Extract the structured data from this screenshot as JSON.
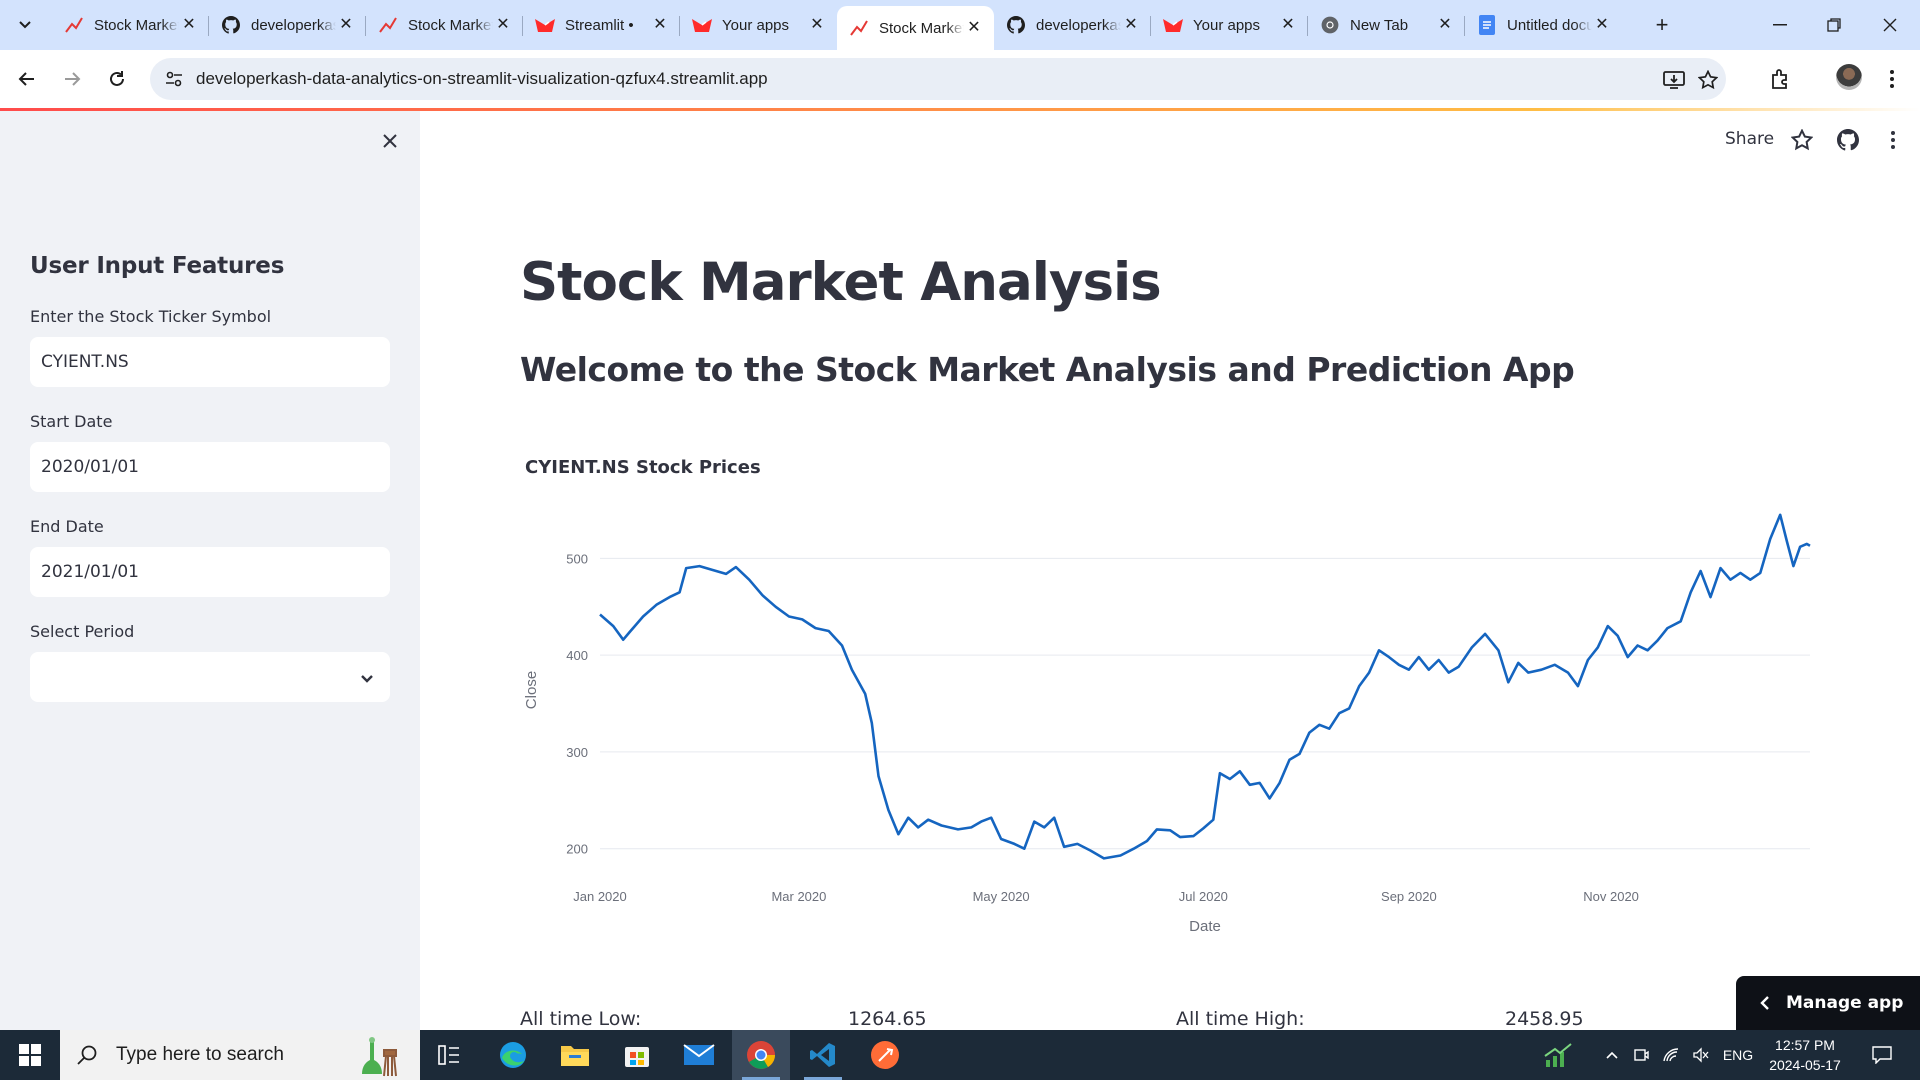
{
  "browser": {
    "tabs": [
      {
        "title": "Stock Market Analysis",
        "icon": "trend-icon",
        "active": false
      },
      {
        "title": "developerkash",
        "icon": "github-icon",
        "active": false
      },
      {
        "title": "Stock Market Analysis",
        "icon": "trend-icon",
        "active": false
      },
      {
        "title": "Streamlit • ",
        "icon": "streamlit-icon",
        "active": false
      },
      {
        "title": "Your apps",
        "icon": "streamlit-icon",
        "active": false
      },
      {
        "title": "Stock Market Analysis",
        "icon": "trend-icon",
        "active": true
      },
      {
        "title": "developerkash",
        "icon": "github-icon",
        "active": false
      },
      {
        "title": "Your apps",
        "icon": "streamlit-icon",
        "active": false
      },
      {
        "title": "New Tab",
        "icon": "chrome-icon",
        "active": false
      },
      {
        "title": "Untitled document",
        "icon": "docs-icon",
        "active": false
      }
    ],
    "url": "developerkash-data-analytics-on-streamlit-visualization-qzfux4.streamlit.app"
  },
  "sidebar": {
    "heading": "User Input Features",
    "ticker_label": "Enter the Stock Ticker Symbol",
    "ticker_value": "CYIENT.NS",
    "start_label": "Start Date",
    "start_value": "2020/01/01",
    "end_label": "End Date",
    "end_value": "2021/01/01",
    "period_label": "Select Period",
    "period_value": ""
  },
  "header": {
    "share_label": "Share"
  },
  "main": {
    "title": "Stock Market Analysis",
    "subtitle": "Welcome to the Stock Market Analysis and Prediction App",
    "chart_title": "CYIENT.NS Stock Prices",
    "low_label": "All time Low:",
    "low_value": "1264.65",
    "high_label": "All time High:",
    "high_value": "2458.95",
    "manage_label": "Manage app"
  },
  "chart_data": {
    "type": "line",
    "title": "CYIENT.NS Stock Prices",
    "xlabel": "Date",
    "ylabel": "Close",
    "ylim": [
      178,
      550
    ],
    "xlim": [
      "2020-01-01",
      "2020-12-31"
    ],
    "grid": true,
    "line_color": "#1565c0",
    "xticks": [
      {
        "date": "2020-01-01",
        "label": "Jan 2020"
      },
      {
        "date": "2020-03-01",
        "label": "Mar 2020"
      },
      {
        "date": "2020-05-01",
        "label": "May 2020"
      },
      {
        "date": "2020-07-01",
        "label": "Jul 2020"
      },
      {
        "date": "2020-09-01",
        "label": "Sep 2020"
      },
      {
        "date": "2020-11-01",
        "label": "Nov 2020"
      }
    ],
    "yticks": [
      200,
      300,
      400,
      500
    ],
    "series": [
      {
        "values": [
          {
            "x": "2020-01-01",
            "y": 442
          },
          {
            "x": "2020-01-05",
            "y": 430
          },
          {
            "x": "2020-01-08",
            "y": 416
          },
          {
            "x": "2020-01-10",
            "y": 424
          },
          {
            "x": "2020-01-14",
            "y": 440
          },
          {
            "x": "2020-01-18",
            "y": 452
          },
          {
            "x": "2020-01-22",
            "y": 460
          },
          {
            "x": "2020-01-25",
            "y": 465
          },
          {
            "x": "2020-01-27",
            "y": 490
          },
          {
            "x": "2020-01-31",
            "y": 492
          },
          {
            "x": "2020-02-04",
            "y": 488
          },
          {
            "x": "2020-02-08",
            "y": 484
          },
          {
            "x": "2020-02-11",
            "y": 491
          },
          {
            "x": "2020-02-15",
            "y": 478
          },
          {
            "x": "2020-02-19",
            "y": 462
          },
          {
            "x": "2020-02-23",
            "y": 450
          },
          {
            "x": "2020-02-27",
            "y": 440
          },
          {
            "x": "2020-03-02",
            "y": 437
          },
          {
            "x": "2020-03-06",
            "y": 428
          },
          {
            "x": "2020-03-10",
            "y": 425
          },
          {
            "x": "2020-03-14",
            "y": 410
          },
          {
            "x": "2020-03-17",
            "y": 385
          },
          {
            "x": "2020-03-21",
            "y": 360
          },
          {
            "x": "2020-03-23",
            "y": 330
          },
          {
            "x": "2020-03-25",
            "y": 275
          },
          {
            "x": "2020-03-28",
            "y": 240
          },
          {
            "x": "2020-03-31",
            "y": 215
          },
          {
            "x": "2020-04-03",
            "y": 232
          },
          {
            "x": "2020-04-06",
            "y": 222
          },
          {
            "x": "2020-04-09",
            "y": 230
          },
          {
            "x": "2020-04-13",
            "y": 224
          },
          {
            "x": "2020-04-18",
            "y": 220
          },
          {
            "x": "2020-04-22",
            "y": 222
          },
          {
            "x": "2020-04-25",
            "y": 228
          },
          {
            "x": "2020-04-28",
            "y": 232
          },
          {
            "x": "2020-05-01",
            "y": 210
          },
          {
            "x": "2020-05-05",
            "y": 205
          },
          {
            "x": "2020-05-08",
            "y": 200
          },
          {
            "x": "2020-05-11",
            "y": 228
          },
          {
            "x": "2020-05-14",
            "y": 222
          },
          {
            "x": "2020-05-17",
            "y": 232
          },
          {
            "x": "2020-05-20",
            "y": 202
          },
          {
            "x": "2020-05-24",
            "y": 205
          },
          {
            "x": "2020-05-28",
            "y": 198
          },
          {
            "x": "2020-06-01",
            "y": 190
          },
          {
            "x": "2020-06-06",
            "y": 193
          },
          {
            "x": "2020-06-10",
            "y": 200
          },
          {
            "x": "2020-06-14",
            "y": 208
          },
          {
            "x": "2020-06-17",
            "y": 220
          },
          {
            "x": "2020-06-21",
            "y": 219
          },
          {
            "x": "2020-06-24",
            "y": 212
          },
          {
            "x": "2020-06-28",
            "y": 213
          },
          {
            "x": "2020-07-01",
            "y": 221
          },
          {
            "x": "2020-07-04",
            "y": 230
          },
          {
            "x": "2020-07-06",
            "y": 278
          },
          {
            "x": "2020-07-09",
            "y": 272
          },
          {
            "x": "2020-07-12",
            "y": 280
          },
          {
            "x": "2020-07-15",
            "y": 266
          },
          {
            "x": "2020-07-18",
            "y": 268
          },
          {
            "x": "2020-07-21",
            "y": 252
          },
          {
            "x": "2020-07-24",
            "y": 268
          },
          {
            "x": "2020-07-27",
            "y": 292
          },
          {
            "x": "2020-07-30",
            "y": 298
          },
          {
            "x": "2020-08-02",
            "y": 320
          },
          {
            "x": "2020-08-05",
            "y": 328
          },
          {
            "x": "2020-08-08",
            "y": 324
          },
          {
            "x": "2020-08-11",
            "y": 340
          },
          {
            "x": "2020-08-14",
            "y": 345
          },
          {
            "x": "2020-08-17",
            "y": 368
          },
          {
            "x": "2020-08-20",
            "y": 382
          },
          {
            "x": "2020-08-23",
            "y": 405
          },
          {
            "x": "2020-08-26",
            "y": 398
          },
          {
            "x": "2020-08-29",
            "y": 390
          },
          {
            "x": "2020-09-01",
            "y": 385
          },
          {
            "x": "2020-09-04",
            "y": 398
          },
          {
            "x": "2020-09-07",
            "y": 385
          },
          {
            "x": "2020-09-10",
            "y": 395
          },
          {
            "x": "2020-09-13",
            "y": 382
          },
          {
            "x": "2020-09-16",
            "y": 388
          },
          {
            "x": "2020-09-20",
            "y": 408
          },
          {
            "x": "2020-09-24",
            "y": 422
          },
          {
            "x": "2020-09-28",
            "y": 405
          },
          {
            "x": "2020-10-01",
            "y": 372
          },
          {
            "x": "2020-10-04",
            "y": 392
          },
          {
            "x": "2020-10-07",
            "y": 382
          },
          {
            "x": "2020-10-11",
            "y": 385
          },
          {
            "x": "2020-10-15",
            "y": 390
          },
          {
            "x": "2020-10-19",
            "y": 382
          },
          {
            "x": "2020-10-22",
            "y": 368
          },
          {
            "x": "2020-10-25",
            "y": 395
          },
          {
            "x": "2020-10-28",
            "y": 408
          },
          {
            "x": "2020-10-31",
            "y": 430
          },
          {
            "x": "2020-11-03",
            "y": 420
          },
          {
            "x": "2020-11-06",
            "y": 398
          },
          {
            "x": "2020-11-09",
            "y": 410
          },
          {
            "x": "2020-11-12",
            "y": 405
          },
          {
            "x": "2020-11-15",
            "y": 415
          },
          {
            "x": "2020-11-18",
            "y": 428
          },
          {
            "x": "2020-11-22",
            "y": 435
          },
          {
            "x": "2020-11-25",
            "y": 465
          },
          {
            "x": "2020-11-28",
            "y": 487
          },
          {
            "x": "2020-12-01",
            "y": 460
          },
          {
            "x": "2020-12-04",
            "y": 490
          },
          {
            "x": "2020-12-07",
            "y": 478
          },
          {
            "x": "2020-12-10",
            "y": 485
          },
          {
            "x": "2020-12-13",
            "y": 478
          },
          {
            "x": "2020-12-16",
            "y": 485
          },
          {
            "x": "2020-12-19",
            "y": 520
          },
          {
            "x": "2020-12-22",
            "y": 545
          },
          {
            "x": "2020-12-24",
            "y": 518
          },
          {
            "x": "2020-12-26",
            "y": 492
          },
          {
            "x": "2020-12-28",
            "y": 512
          },
          {
            "x": "2020-12-30",
            "y": 515
          },
          {
            "x": "2020-12-31",
            "y": 513
          }
        ]
      }
    ]
  },
  "taskbar": {
    "search_placeholder": "Type here to search",
    "language": "ENG",
    "time": "12:57 PM",
    "date": "2024-05-17"
  }
}
